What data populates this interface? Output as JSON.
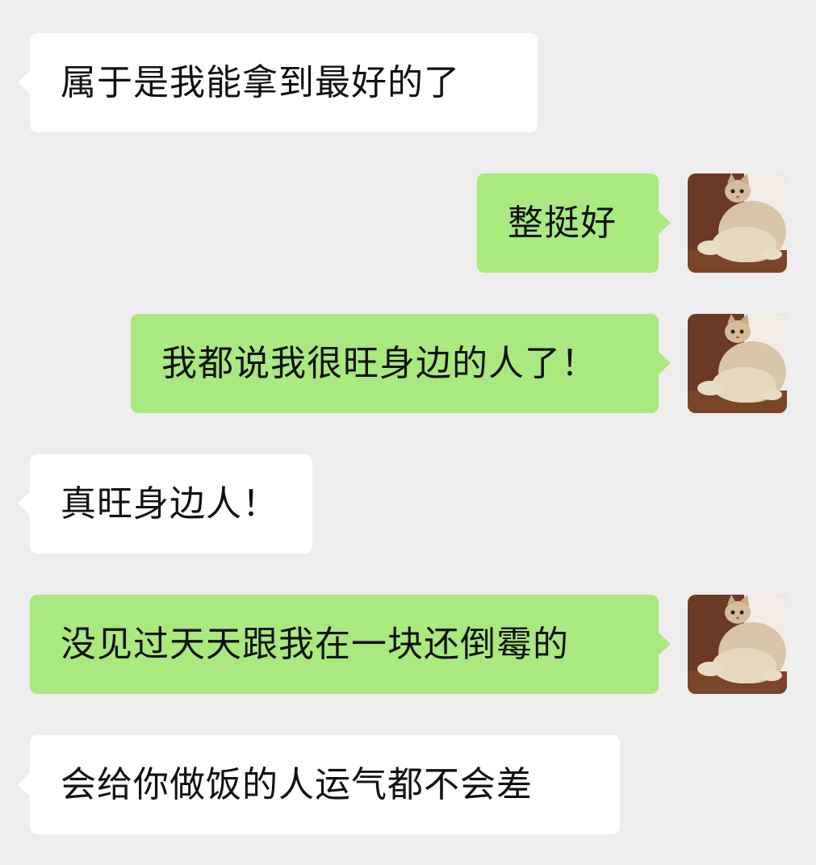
{
  "messages": [
    {
      "side": "in",
      "text": "属于是我能拿到最好的了"
    },
    {
      "side": "out",
      "text": "整挺好"
    },
    {
      "side": "out",
      "text": "我都说我很旺身边的人了！"
    },
    {
      "side": "in",
      "text": "真旺身边人！"
    },
    {
      "side": "out",
      "text": "没见过天天跟我在一块还倒霉的"
    },
    {
      "side": "in",
      "text": "会给你做饭的人运气都不会差"
    }
  ],
  "colors": {
    "background": "#ededed",
    "incoming_bubble": "#ffffff",
    "outgoing_bubble": "#a9e97f",
    "text": "#111111"
  },
  "avatar_icon": "cat-avatar-icon"
}
